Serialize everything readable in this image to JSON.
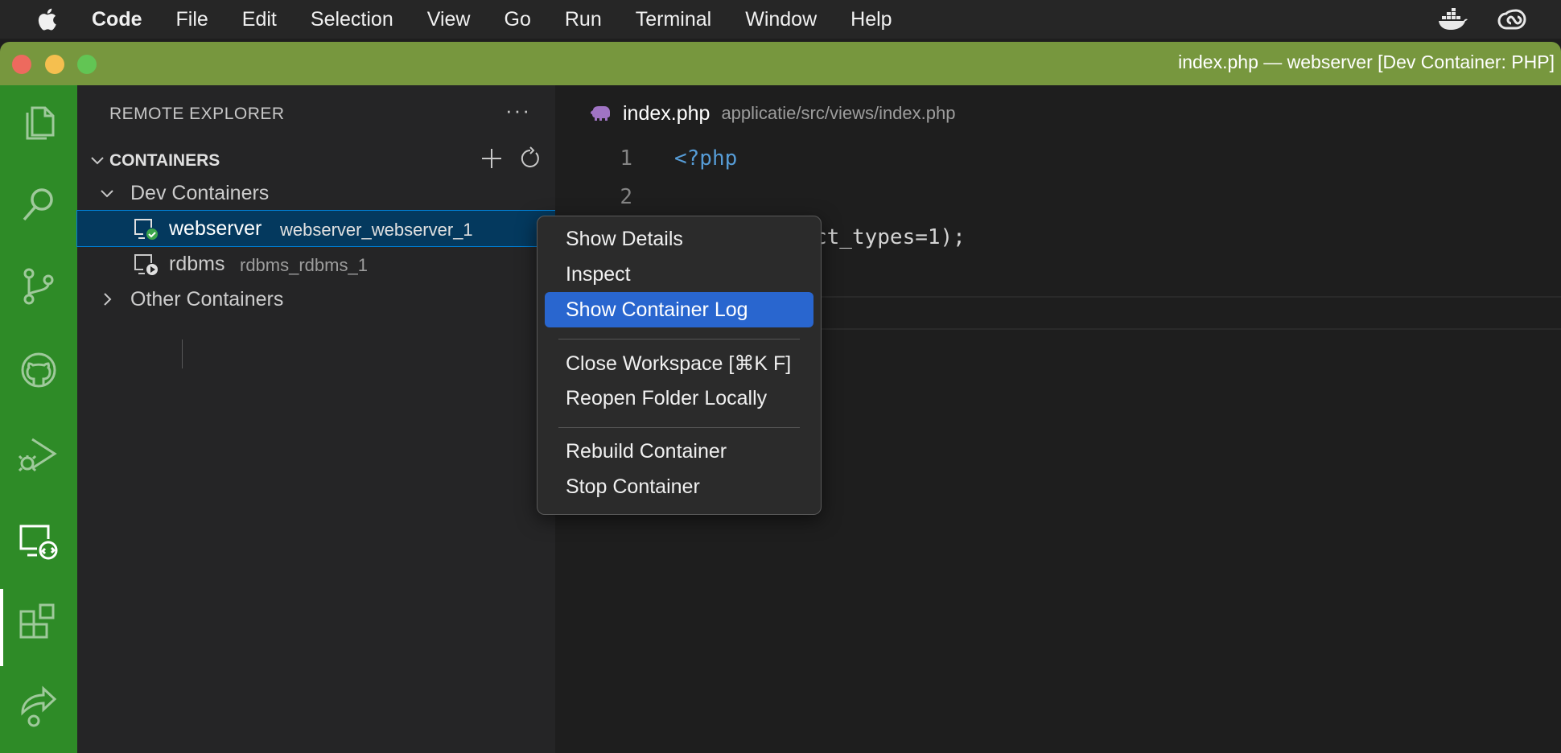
{
  "menubar": {
    "app": "Code",
    "items": [
      "File",
      "Edit",
      "Selection",
      "View",
      "Go",
      "Run",
      "Terminal",
      "Window",
      "Help"
    ]
  },
  "window": {
    "title": "index.php — webserver [Dev Container: PHP]",
    "accent_color": "#77973e",
    "activity_bar_color": "#2e8b27"
  },
  "activity_bar": {
    "icons": [
      "files-icon",
      "search-icon",
      "source-control-icon",
      "github-icon",
      "run-debug-icon",
      "remote-explorer-icon",
      "extensions-icon",
      "live-share-icon"
    ],
    "active": "remote-explorer-icon"
  },
  "sidebar": {
    "title": "REMOTE EXPLORER",
    "more_label": "···",
    "section": "CONTAINERS",
    "groups": [
      {
        "label": "Dev Containers",
        "expanded": true,
        "items": [
          {
            "name": "webserver",
            "desc": "webserver_webserver_1",
            "status": "running"
          },
          {
            "name": "rdbms",
            "desc": "rdbms_rdbms_1",
            "status": "stopped"
          }
        ]
      },
      {
        "label": "Other Containers",
        "expanded": false
      }
    ]
  },
  "editor": {
    "file": "index.php",
    "path": "applicatie/src/views/index.php",
    "lines": [
      {
        "num": "1",
        "text": "<?php"
      },
      {
        "num": "2",
        "text": ""
      },
      {
        "num": "",
        "text": "ct_types=1);"
      }
    ]
  },
  "context_menu": {
    "items": [
      "Show Details",
      "Inspect",
      "Show Container Log",
      "Close Workspace [⌘K F]",
      "Reopen Folder Locally",
      "Rebuild Container",
      "Stop Container"
    ],
    "highlighted": "Show Container Log",
    "highlight_color": "#2966cf"
  }
}
